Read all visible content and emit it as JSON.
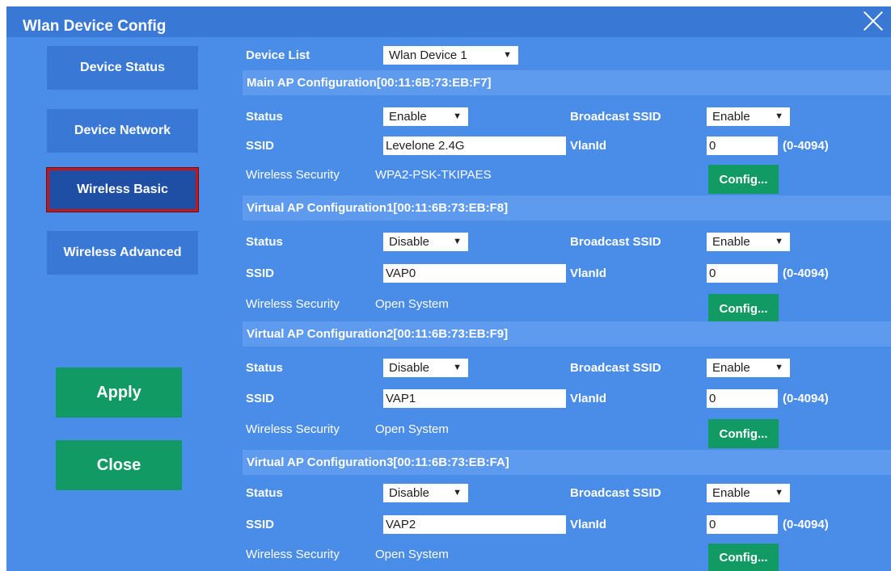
{
  "window": {
    "title": "Wlan Device Config"
  },
  "sidebar": {
    "items": [
      {
        "label": "Device Status"
      },
      {
        "label": "Device Network"
      },
      {
        "label": "Wireless Basic"
      },
      {
        "label": "Wireless Advanced"
      }
    ],
    "active": "Wireless Basic",
    "apply_label": "Apply",
    "close_label": "Close"
  },
  "device_list": {
    "label": "Device List",
    "selected": "Wlan Device 1"
  },
  "labels": {
    "status": "Status",
    "broadcast_ssid": "Broadcast SSID",
    "ssid": "SSID",
    "vlanid": "VlanId",
    "vlan_range": "(0-4094)",
    "wireless_security": "Wireless Security",
    "config_button": "Config..."
  },
  "sections": [
    {
      "title": "Main AP Configuration[00:11:6B:73:EB:F7]",
      "status": "Enable",
      "broadcast_ssid": "Enable",
      "ssid": "Levelone 2.4G",
      "vlanid": "0",
      "security": "WPA2-PSK-TKIPAES"
    },
    {
      "title": "Virtual AP Configuration1[00:11:6B:73:EB:F8]",
      "status": "Disable",
      "broadcast_ssid": "Enable",
      "ssid": "VAP0",
      "vlanid": "0",
      "security": "Open System"
    },
    {
      "title": "Virtual AP Configuration2[00:11:6B:73:EB:F9]",
      "status": "Disable",
      "broadcast_ssid": "Enable",
      "ssid": "VAP1",
      "vlanid": "0",
      "security": "Open System"
    },
    {
      "title": "Virtual AP Configuration3[00:11:6B:73:EB:FA]",
      "status": "Disable",
      "broadcast_ssid": "Enable",
      "ssid": "VAP2",
      "vlanid": "0",
      "security": "Open System"
    }
  ],
  "colors": {
    "dialog_bg": "#4a8de8",
    "titlebar": "#3a78d6",
    "section_bar": "#5e9bef",
    "nav_active": "#1f4fa4",
    "active_border": "#c0181d",
    "action_green": "#129a65"
  }
}
